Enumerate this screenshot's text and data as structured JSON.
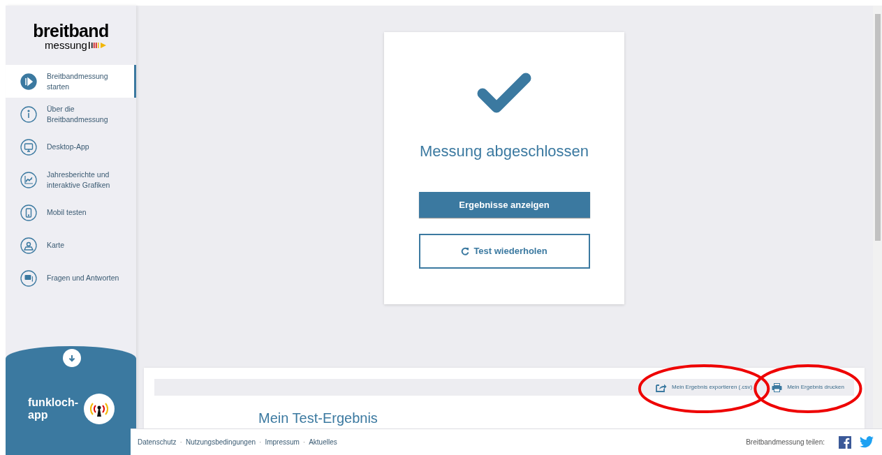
{
  "logo": {
    "line_1": "breitband",
    "line_2": "messung"
  },
  "sidebar": {
    "items": [
      {
        "label": "Breitbandmessung starten",
        "kind": "play",
        "selected": true
      },
      {
        "label": "Über die Breitbandmessung",
        "kind": "info",
        "selected": false
      },
      {
        "label": "Desktop-App",
        "kind": "monitor",
        "selected": false
      },
      {
        "label": "Jahresberichte und interaktive Grafiken",
        "kind": "chart",
        "selected": false
      },
      {
        "label": "Mobil testen",
        "kind": "phone",
        "selected": false
      },
      {
        "label": "Karte",
        "kind": "map",
        "selected": false
      },
      {
        "label": "Fragen und Antworten",
        "kind": "chat",
        "selected": false
      }
    ],
    "promo": {
      "line_1": "funkloch-",
      "line_2": "app"
    }
  },
  "result_card": {
    "title": "Messung abgeschlossen",
    "primary_button": "Ergebnisse anzeigen",
    "secondary_button": "Test wiederholen"
  },
  "result_panel": {
    "actions": [
      {
        "label": "Mein Ergebnis exportieren (.csv)",
        "kind": "export",
        "highlighted": true
      },
      {
        "label": "Mein Ergebnis drucken",
        "kind": "print",
        "highlighted": true
      }
    ],
    "heading": "Mein Test-Ergebnis"
  },
  "footer": {
    "links": [
      {
        "label": "Datenschutz"
      },
      {
        "separator": "·",
        "label": "Nutzungsbedingungen"
      },
      {
        "separator": "·",
        "label": "Impressum"
      },
      {
        "separator": "·",
        "label": "Aktuelles"
      }
    ],
    "share_label": "Breitbandmessung teilen:"
  }
}
